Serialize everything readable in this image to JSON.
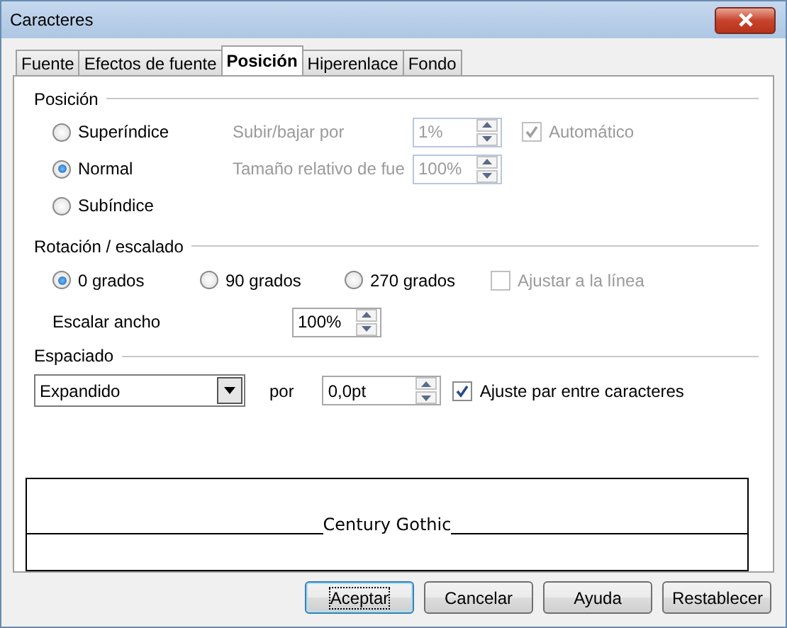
{
  "window": {
    "title": "Caracteres"
  },
  "tabs": [
    {
      "label": "Fuente",
      "selected": false
    },
    {
      "label": "Efectos de fuente",
      "selected": false
    },
    {
      "label": "Posición",
      "selected": true
    },
    {
      "label": "Hiperenlace",
      "selected": false
    },
    {
      "label": "Fondo",
      "selected": false
    }
  ],
  "position": {
    "title": "Posición",
    "options": [
      {
        "label": "Superíndice",
        "selected": false
      },
      {
        "label": "Normal",
        "selected": true
      },
      {
        "label": "Subíndice",
        "selected": false
      }
    ],
    "raise_lower": {
      "label": "Subir/bajar por",
      "value": "1%",
      "disabled": true
    },
    "relative_size": {
      "label": "Tamaño relativo de fue",
      "value": "100%",
      "disabled": true
    },
    "automatic": {
      "label": "Automático",
      "checked": true,
      "disabled": true
    }
  },
  "rotation": {
    "title": "Rotación / escalado",
    "options": [
      {
        "label": "0 grados",
        "selected": true
      },
      {
        "label": "90 grados",
        "selected": false
      },
      {
        "label": "270 grados",
        "selected": false
      }
    ],
    "fit_to_line": {
      "label": "Ajustar a la línea",
      "checked": false,
      "disabled": true
    },
    "scale_width": {
      "label": "Escalar ancho",
      "value": "100%"
    }
  },
  "spacing": {
    "title": "Espaciado",
    "mode": "Expandido",
    "by_label": "por",
    "by_value": "0,0pt",
    "pair_kerning": {
      "label": "Ajuste par entre caracteres",
      "checked": true
    }
  },
  "preview": {
    "text": "Century Gothic"
  },
  "buttons": [
    {
      "label": "Aceptar",
      "default": true
    },
    {
      "label": "Cancelar",
      "default": false
    },
    {
      "label": "Ayuda",
      "default": false
    },
    {
      "label": "Restablecer",
      "default": false
    }
  ]
}
